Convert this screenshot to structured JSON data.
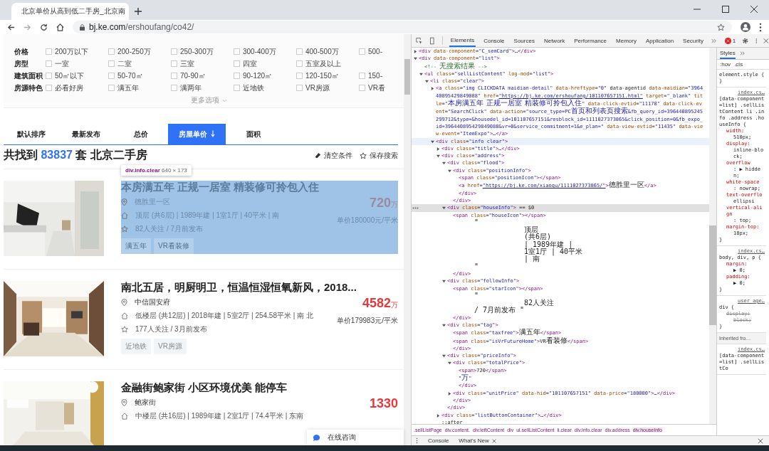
{
  "browser": {
    "tab_title": "北京单价从高到低二手房_北京南",
    "url_host": "bj.ke.com",
    "url_path": "/ershoufang/co42/"
  },
  "filters": [
    {
      "label": "价格",
      "options": [
        {
          "text": "200万以下",
          "checked": false
        },
        {
          "text": "200-250万",
          "checked": false
        },
        {
          "text": "250-300万",
          "checked": false
        },
        {
          "text": "300-400万",
          "checked": false
        },
        {
          "text": "400-500万",
          "checked": false
        },
        {
          "text": "500-",
          "checked": false
        }
      ]
    },
    {
      "label": "房型",
      "options": [
        {
          "text": "一室",
          "checked": false
        },
        {
          "text": "二室",
          "checked": false
        },
        {
          "text": "三室",
          "checked": false
        },
        {
          "text": "四室",
          "checked": false
        },
        {
          "text": "五室及以上",
          "checked": false
        }
      ]
    },
    {
      "label": "建筑面积",
      "options": [
        {
          "text": "50㎡以下",
          "checked": false
        },
        {
          "text": "50-70㎡",
          "checked": false
        },
        {
          "text": "70-90㎡",
          "checked": false
        },
        {
          "text": "90-120㎡",
          "checked": false
        },
        {
          "text": "120-150㎡",
          "checked": false
        },
        {
          "text": "150-",
          "checked": false
        }
      ]
    },
    {
      "label": "房源特色",
      "options": [
        {
          "text": "必看好房",
          "checked": false
        },
        {
          "text": "满五年",
          "checked": false
        },
        {
          "text": "满两年",
          "checked": false
        },
        {
          "text": "近地铁",
          "checked": false
        },
        {
          "text": "VR房源",
          "checked": false
        },
        {
          "text": "VR看",
          "checked": false
        }
      ]
    }
  ],
  "more_options": "更多选项",
  "sort_tabs": [
    {
      "label": "默认排序",
      "selected": false,
      "arrow": false
    },
    {
      "label": "最新发布",
      "selected": false,
      "arrow": false
    },
    {
      "label": "总价",
      "selected": false,
      "arrow": false
    },
    {
      "label": "房屋单价",
      "selected": true,
      "arrow": true
    },
    {
      "label": "面积",
      "selected": false,
      "arrow": false
    }
  ],
  "result": {
    "prefix": "共找到",
    "count": "83837",
    "suffix": "套 北京二手房"
  },
  "actions": [
    "清空条件",
    "保存搜索"
  ],
  "inspect_tooltip": {
    "selector": "div.info.clear",
    "size": "640 × 173"
  },
  "listings": [
    {
      "title": "本房满五年 正规一居室 精装修可拎包入住",
      "highlighted": true,
      "community": "德胜里一区",
      "house_info": "顶层 (共6层) | 1989年建 | 1室1厅 | 40平米 | 南",
      "follow_info": "82人关注 / 7月前发布",
      "tags": [
        "满五年",
        "VR看装修"
      ],
      "total_price": "720",
      "price_unit": "万",
      "unit_price": "单价180000元/平米"
    },
    {
      "title": "南北五居，明厨明卫，恒温恒湿恒氧新风，2018...",
      "highlighted": false,
      "community": "中信国安府",
      "house_info": "低楼层 (共12层) | 2018年建 | 5室2厅 | 254.58平米 | 南 北",
      "follow_info": "177人关注 / 3月前发布",
      "tags": [
        "近地铁",
        "VR房源"
      ],
      "total_price": "4582",
      "price_unit": "万",
      "unit_price": "单价179983元/平米"
    },
    {
      "title": "金融街鲍家街 小区环境优美 能停车",
      "highlighted": false,
      "community": "鲍家街",
      "house_info": "中楼层 (共16层) | 1989年建 | 2室1厅 | 74.4平米 | 东南",
      "total_price": "1330"
    }
  ],
  "chat_button": "在线咨询",
  "devtools": {
    "tabs": [
      {
        "label": "Elements",
        "selected": true
      },
      {
        "label": "Console",
        "selected": false
      },
      {
        "label": "Sources",
        "selected": false
      },
      {
        "label": "Network",
        "selected": false
      },
      {
        "label": "Performance",
        "selected": false
      },
      {
        "label": "Memory",
        "selected": false
      },
      {
        "label": "Application",
        "selected": false
      },
      {
        "label": "Security",
        "selected": false
      }
    ],
    "error_count": "1",
    "dom": [
      {
        "text": "<div data-component=\"C_semCard\">…</div>",
        "expanded": false,
        "selected": false,
        "hovered": false
      },
      {
        "text": "<div data-component=\"list\">",
        "expanded": true,
        "selected": false,
        "hovered": false,
        "children": [
          {
            "text": "<!-- 无搜索结果 -->",
            "selected": false,
            "hovered": false
          },
          {
            "text": "<ul class=\"sellListContent\" log-mod=\"list\">",
            "expanded": true,
            "selected": false,
            "hovered": false,
            "children": [
              {
                "text": "<li class=\"clear\">",
                "expanded": true,
                "selected": false,
                "hovered": false,
                "children": [
                  {
                    "text": "<a class=\"img  CLICKDATA maidian-detail\" data-hreftype=\"0\" data-agentid data-maidian=\"396440895429849088\" href=\"https://bj.ke.com/ershoufang/101107657151.html\" target=\"_blank\" title=\"本房满五年 正规一居室 精装修可拎包入住\" data-click-evtid=\"11178\" data-click-event=\"SearchClick\" data-action=\"source_type=PC首页和列表页搜索&fb_query_id=396440895245299712&type=&housedel_id=101107657151&resblock_id=1111027373865&click_position=0&fb_expo_id=396440895429849088&vr=0&service_commitment=1&e_plan=\" data-view-evtid=\"11435\" data-view-event=\"ItemExpo\">…</a>",
                    "expanded": false,
                    "selected": false,
                    "hovered": false
                  },
                  {
                    "text": "<div class=\"info clear\">",
                    "expanded": true,
                    "selected": false,
                    "hovered": true,
                    "children": [
                      {
                        "text": "<div class=\"title\">…</div>",
                        "expanded": false,
                        "selected": false,
                        "hovered": false
                      },
                      {
                        "text": "<div class=\"address\">",
                        "expanded": true,
                        "selected": false,
                        "hovered": false,
                        "children": [
                          {
                            "text": "<div class=\"flood\">",
                            "expanded": true,
                            "selected": false,
                            "hovered": false,
                            "children": [
                              {
                                "text": "<div class=\"positionInfo\">",
                                "expanded": true,
                                "selected": false,
                                "hovered": false,
                                "children": [
                                  {
                                    "text": "<span class=\"positionIcon\"></span>",
                                    "selected": false,
                                    "hovered": false
                                  },
                                  {
                                    "text": "<a href=\"https://bj.ke.com/xiaoqu/1111027373865/\">德胜里一区</a>",
                                    "selected": false,
                                    "hovered": false
                                  },
                                  {
                                    "text": "</div>",
                                    "selected": false,
                                    "hovered": false
                                  }
                                ]
                              },
                              {
                                "text": "</div>",
                                "selected": false,
                                "hovered": false
                              }
                            ]
                          },
                          {
                            "text": "<div class=\"houseInfo\"> == $0",
                            "expanded": true,
                            "selected": true,
                            "hovered": false,
                            "children": [
                              {
                                "text": "<span class=\"houseIcon\"></span>",
                                "selected": false,
                                "hovered": false
                              },
                              {
                                "text_lines": [
                                  "\"",
                                  "顶层",
                                  "(共6层)",
                                  "| 1989年建 |",
                                  "1室1厅  | 40平米",
                                  "| 南",
                                  "\""
                                ],
                                "selected": false,
                                "hovered": false
                              },
                              {
                                "text": "</div>",
                                "selected": false,
                                "hovered": false
                              }
                            ]
                          },
                          {
                            "text": "<div class=\"followInfo\">",
                            "expanded": true,
                            "selected": false,
                            "hovered": false,
                            "children": [
                              {
                                "text": "<span class=\"starIcon\"></span>",
                                "selected": false,
                                "hovered": false
                              },
                              {
                                "text_lines": [
                                  "\"",
                                  "82人关注",
                                  "/ 7月前发布                \""
                                ],
                                "selected": false,
                                "hovered": false
                              },
                              {
                                "text": "</div>",
                                "selected": false,
                                "hovered": false
                              }
                            ]
                          },
                          {
                            "text": "<div class=\"tag\">",
                            "expanded": true,
                            "selected": false,
                            "hovered": false,
                            "children": [
                              {
                                "text": "<span class=\"taxfree\">满五年</span>",
                                "selected": false,
                                "hovered": false
                              },
                              {
                                "text": "<span class=\"isVrFutureHome\">VR看装修</span>",
                                "selected": false,
                                "hovered": false
                              },
                              {
                                "text": "</div>",
                                "selected": false,
                                "hovered": false
                              }
                            ]
                          },
                          {
                            "text": "<div class=\"priceInfo\">",
                            "expanded": true,
                            "selected": false,
                            "hovered": false,
                            "children": [
                              {
                                "text": "<div class=\"totalPrice\">",
                                "expanded": true,
                                "selected": false,
                                "hovered": false,
                                "children": [
                                  {
                                    "text": "<span>720</span>",
                                    "selected": false,
                                    "hovered": false
                                  },
                                  {
                                    "text": "\"万\"",
                                    "selected": false,
                                    "hovered": false
                                  },
                                  {
                                    "text": "</div>",
                                    "selected": false,
                                    "hovered": false
                                  }
                                ]
                              },
                              {
                                "text": "<div class=\"unitPrice\" data-hid=\"101107657151\" data-price=\"180000\">…</div>",
                                "expanded": false,
                                "selected": false,
                                "hovered": false
                              },
                              {
                                "text": "</div>",
                                "selected": false,
                                "hovered": false
                              }
                            ]
                          },
                          {
                            "text": "</div>",
                            "selected": false,
                            "hovered": false
                          }
                        ]
                      },
                      {
                        "text": "<div class=\"listButtonContainer\">…</div>",
                        "expanded": false,
                        "selected": false,
                        "hovered": false
                      },
                      {
                        "text": "::after",
                        "selected": false,
                        "hovered": false
                      }
                    ]
                  }
                ]
              }
            ]
          }
        ]
      }
    ],
    "styles_tabs": [
      {
        "label": "Styles",
        "selected": true
      }
    ],
    "filter_buttons": [
      ":hov",
      ".cls"
    ],
    "rules": [
      {
        "selector": "element.style {",
        "close": "}"
      },
      {
        "source": "index.cs…",
        "selector": "[data-component=list] .sellListContent li .info .address .houseInfo {",
        "declarations": [
          {
            "property": "width:",
            "value": "510px;",
            "struck": false
          },
          {
            "property": "display:",
            "value": "inline-block;",
            "struck": false
          },
          {
            "property": "overflow",
            "value": ": ▶ hidden;",
            "struck": false
          },
          {
            "property": "white-space",
            "value": ": nowrap;",
            "struck": false
          },
          {
            "property": "text-overflo",
            "value": "ellipsi",
            "struck": false
          },
          {
            "property": "vertical-align",
            "value": ": top;",
            "struck": false
          },
          {
            "property": "margin-top:",
            "value": "18px;",
            "struck": false
          }
        ],
        "close": "}"
      },
      {
        "source": "index.cs…",
        "selector": "body, div, p {",
        "declarations": [
          {
            "property": "margin:",
            "value": "▶ 0;",
            "struck": false
          },
          {
            "property": "padding:",
            "value": "▶ 0;",
            "struck": false
          }
        ],
        "close": "}"
      },
      {
        "source": "user age…",
        "selector": "div {",
        "declarations": [
          {
            "property": "display:",
            "value": "block;",
            "struck": true
          }
        ],
        "close": "}"
      },
      {
        "header": "Inherited fro…"
      },
      {
        "source": "index.cs…",
        "selector": "[data-component=list] .sellListCo"
      }
    ],
    "breadcrumbs": [
      {
        "label": ".sellListPage",
        "selected": false
      },
      {
        "label": "div.content.",
        "selected": false
      },
      {
        "label": "div.leftContent",
        "selected": false
      },
      {
        "label": "div",
        "selected": false
      },
      {
        "label": "ul.sellListContent",
        "selected": false
      },
      {
        "label": "li.clear",
        "selected": false
      },
      {
        "label": "div.info.clear",
        "selected": false
      },
      {
        "label": "div.address",
        "selected": false
      },
      {
        "label": "div.houseInfo",
        "selected": true
      }
    ],
    "drawer_tabs": [
      {
        "label": "Console",
        "closable": false
      },
      {
        "label": "What's New",
        "closable": true
      }
    ]
  }
}
